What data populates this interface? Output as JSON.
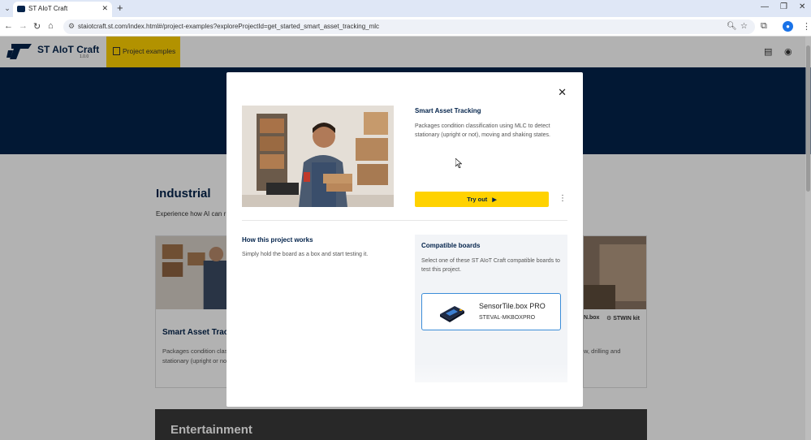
{
  "browser": {
    "tab_title": "ST AIoT Craft",
    "url": "staiotcraft.st.com/index.html#/project-examples?exploreProjectId=get_started_smart_asset_tracking_mlc",
    "icons": [
      "tab-search-icon",
      "back-icon",
      "forward-icon",
      "reload-icon",
      "home-icon",
      "site-info-icon",
      "zoom-icon",
      "bookmark-star-icon",
      "extensions-icon",
      "profile-icon",
      "kebab-menu-icon",
      "minimize-icon",
      "maximize-icon",
      "close-icon"
    ]
  },
  "app": {
    "name": "ST AIoT Craft",
    "version": "1.0.0",
    "nav_item": "Project examples",
    "header_icons": [
      "document-icon",
      "account-icon"
    ],
    "brand_navy": "#03234b",
    "accent_yellow": "#ffd200"
  },
  "background": {
    "section_title": "Industrial",
    "section_desc": "Experience how AI can r",
    "card_left": {
      "title": "Smart Asset Track",
      "desc_line1": "Packages condition class",
      "desc_line2": "stationary (upright or not"
    },
    "card_right": {
      "chip1": "N.box",
      "chip2": "STWIN kit",
      "desc_line1": "w, drilling and"
    },
    "next_section": "Entertainment"
  },
  "modal": {
    "title": "Smart Asset Tracking",
    "description": "Packages condition classification using MLC to detect stationary (upright or not), moving and shaking states.",
    "try_out_label": "Try out",
    "how_title": "How this project works",
    "how_desc": "Simply hold the board as a box and start testing it.",
    "compat_title": "Compatible boards",
    "compat_desc": "Select one of these ST AIoT Craft compatible boards to test this project.",
    "board": {
      "name": "SensorTile.box PRO",
      "code": "STEVAL-MKBOXPRO"
    }
  }
}
